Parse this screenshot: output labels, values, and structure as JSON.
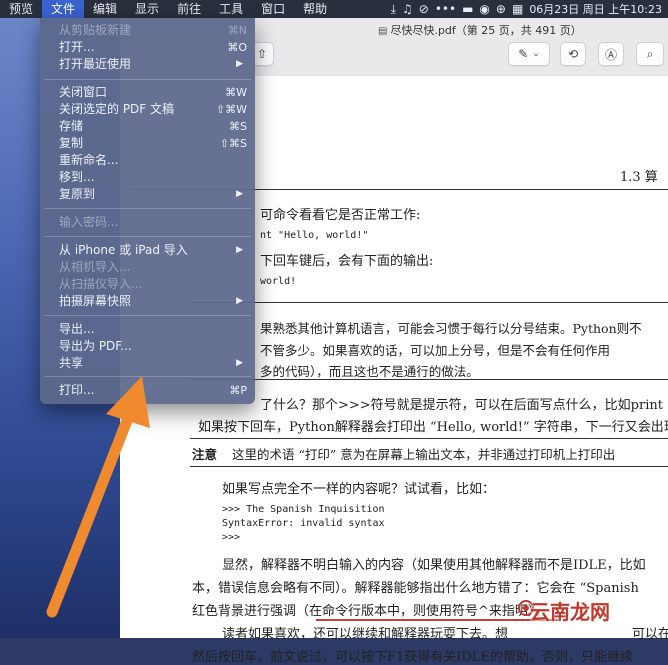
{
  "menubar": {
    "items": [
      "预览",
      "文件",
      "编辑",
      "显示",
      "前往",
      "工具",
      "窗口",
      "帮助"
    ],
    "active": "文件",
    "datetime": "06月23日 周日 上午10:23"
  },
  "toolbar": {
    "title": "尽快尽快.pdf（第 25 页，共 491 页）"
  },
  "file_menu": {
    "items": [
      {
        "label": "从剪贴板新建",
        "shortcut": "⌘N",
        "disabled": true
      },
      {
        "label": "打开...",
        "shortcut": "⌘O"
      },
      {
        "label": "打开最近使用",
        "submenu": true
      },
      {
        "label": "关闭窗口",
        "shortcut": "⌘W"
      },
      {
        "label": "关闭选定的 PDF 文稿",
        "shortcut": "⇧⌘W"
      },
      {
        "label": "存储",
        "shortcut": "⌘S"
      },
      {
        "label": "复制",
        "shortcut": "⇧⌘S"
      },
      {
        "label": "重新命名..."
      },
      {
        "label": "移到..."
      },
      {
        "label": "复原到",
        "submenu": true
      },
      {
        "label": "输入密码...",
        "disabled": true
      },
      {
        "label": "从 iPhone 或 iPad 导入",
        "submenu": true
      },
      {
        "label": "从相机导入...",
        "disabled": true
      },
      {
        "label": "从扫描仪导入...",
        "disabled": true
      },
      {
        "label": "拍摄屏幕快照",
        "submenu": true
      },
      {
        "label": "导出..."
      },
      {
        "label": "导出为 PDF..."
      },
      {
        "label": "共享",
        "submenu": true
      },
      {
        "label": "打印...",
        "shortcut": "⌘P"
      }
    ]
  },
  "pdf": {
    "section": "1.3  算",
    "l1": "可命令看看它是否正常工作:",
    "l2": "nt \"Hello, world!\"",
    "l3": "下回车键后，会有下面的输出:",
    "l4": "world!",
    "l5": "果熟悉其他计算机语言，可能会习惯于每行以分号结束。Python则不",
    "l6": "不管多少。如果喜欢的话，可以加上分号，但是不会有任何作用",
    "l7": "多的代码），而且这也不是通行的做法。",
    "l8": "了什么？那个>>>符号就是提示符，可以在后面写点什么，比如print",
    "l9": "如果按下回车，Python解释器会打印出 “Hello, world!” 字符串，下一行又会出现",
    "note_label": "注意",
    "note_text": "这里的术语 “打印” 意为在屏幕上输出文本，并非通过打印机上打印出",
    "l10": "如果写点完全不一样的内容呢？试试看，比如：",
    "code1": ">>> The Spanish Inquisition",
    "code2": "SyntaxError: invalid syntax",
    "code3": ">>>",
    "l11": "显然，解释器不明白输入的内容（如果使用其他解释器而不是IDLE，比如",
    "l12": "本，错误信息会略有不同）。解释器能够指出什么地方错了：它会在 “Spanish",
    "l13": "红色背景进行强调（在命令行版本中，则使用符号^来指明）。",
    "l14": "读者如果喜欢，还可以继续和解释器玩耍下去。想",
    "l14b": "可以在",
    "l15": "然后按回车。前文说过，可以按下F1获得有关IDLE的帮助。否则，只能继续"
  },
  "watermark": {
    "text": "云南龙网"
  },
  "colors": {
    "menu_highlight": "#3a63d0",
    "arrow": "#f08a2e",
    "underline": "#d23b3b"
  }
}
